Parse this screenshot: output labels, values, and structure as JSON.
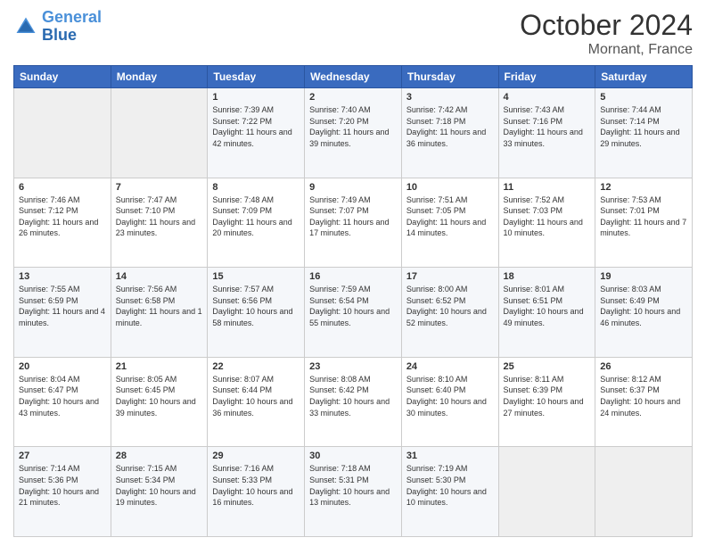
{
  "header": {
    "logo_line1": "General",
    "logo_line2": "Blue",
    "month": "October 2024",
    "location": "Mornant, France"
  },
  "days_of_week": [
    "Sunday",
    "Monday",
    "Tuesday",
    "Wednesday",
    "Thursday",
    "Friday",
    "Saturday"
  ],
  "weeks": [
    [
      {
        "day": "",
        "info": ""
      },
      {
        "day": "",
        "info": ""
      },
      {
        "day": "1",
        "info": "Sunrise: 7:39 AM\nSunset: 7:22 PM\nDaylight: 11 hours and 42 minutes."
      },
      {
        "day": "2",
        "info": "Sunrise: 7:40 AM\nSunset: 7:20 PM\nDaylight: 11 hours and 39 minutes."
      },
      {
        "day": "3",
        "info": "Sunrise: 7:42 AM\nSunset: 7:18 PM\nDaylight: 11 hours and 36 minutes."
      },
      {
        "day": "4",
        "info": "Sunrise: 7:43 AM\nSunset: 7:16 PM\nDaylight: 11 hours and 33 minutes."
      },
      {
        "day": "5",
        "info": "Sunrise: 7:44 AM\nSunset: 7:14 PM\nDaylight: 11 hours and 29 minutes."
      }
    ],
    [
      {
        "day": "6",
        "info": "Sunrise: 7:46 AM\nSunset: 7:12 PM\nDaylight: 11 hours and 26 minutes."
      },
      {
        "day": "7",
        "info": "Sunrise: 7:47 AM\nSunset: 7:10 PM\nDaylight: 11 hours and 23 minutes."
      },
      {
        "day": "8",
        "info": "Sunrise: 7:48 AM\nSunset: 7:09 PM\nDaylight: 11 hours and 20 minutes."
      },
      {
        "day": "9",
        "info": "Sunrise: 7:49 AM\nSunset: 7:07 PM\nDaylight: 11 hours and 17 minutes."
      },
      {
        "day": "10",
        "info": "Sunrise: 7:51 AM\nSunset: 7:05 PM\nDaylight: 11 hours and 14 minutes."
      },
      {
        "day": "11",
        "info": "Sunrise: 7:52 AM\nSunset: 7:03 PM\nDaylight: 11 hours and 10 minutes."
      },
      {
        "day": "12",
        "info": "Sunrise: 7:53 AM\nSunset: 7:01 PM\nDaylight: 11 hours and 7 minutes."
      }
    ],
    [
      {
        "day": "13",
        "info": "Sunrise: 7:55 AM\nSunset: 6:59 PM\nDaylight: 11 hours and 4 minutes."
      },
      {
        "day": "14",
        "info": "Sunrise: 7:56 AM\nSunset: 6:58 PM\nDaylight: 11 hours and 1 minute."
      },
      {
        "day": "15",
        "info": "Sunrise: 7:57 AM\nSunset: 6:56 PM\nDaylight: 10 hours and 58 minutes."
      },
      {
        "day": "16",
        "info": "Sunrise: 7:59 AM\nSunset: 6:54 PM\nDaylight: 10 hours and 55 minutes."
      },
      {
        "day": "17",
        "info": "Sunrise: 8:00 AM\nSunset: 6:52 PM\nDaylight: 10 hours and 52 minutes."
      },
      {
        "day": "18",
        "info": "Sunrise: 8:01 AM\nSunset: 6:51 PM\nDaylight: 10 hours and 49 minutes."
      },
      {
        "day": "19",
        "info": "Sunrise: 8:03 AM\nSunset: 6:49 PM\nDaylight: 10 hours and 46 minutes."
      }
    ],
    [
      {
        "day": "20",
        "info": "Sunrise: 8:04 AM\nSunset: 6:47 PM\nDaylight: 10 hours and 43 minutes."
      },
      {
        "day": "21",
        "info": "Sunrise: 8:05 AM\nSunset: 6:45 PM\nDaylight: 10 hours and 39 minutes."
      },
      {
        "day": "22",
        "info": "Sunrise: 8:07 AM\nSunset: 6:44 PM\nDaylight: 10 hours and 36 minutes."
      },
      {
        "day": "23",
        "info": "Sunrise: 8:08 AM\nSunset: 6:42 PM\nDaylight: 10 hours and 33 minutes."
      },
      {
        "day": "24",
        "info": "Sunrise: 8:10 AM\nSunset: 6:40 PM\nDaylight: 10 hours and 30 minutes."
      },
      {
        "day": "25",
        "info": "Sunrise: 8:11 AM\nSunset: 6:39 PM\nDaylight: 10 hours and 27 minutes."
      },
      {
        "day": "26",
        "info": "Sunrise: 8:12 AM\nSunset: 6:37 PM\nDaylight: 10 hours and 24 minutes."
      }
    ],
    [
      {
        "day": "27",
        "info": "Sunrise: 7:14 AM\nSunset: 5:36 PM\nDaylight: 10 hours and 21 minutes."
      },
      {
        "day": "28",
        "info": "Sunrise: 7:15 AM\nSunset: 5:34 PM\nDaylight: 10 hours and 19 minutes."
      },
      {
        "day": "29",
        "info": "Sunrise: 7:16 AM\nSunset: 5:33 PM\nDaylight: 10 hours and 16 minutes."
      },
      {
        "day": "30",
        "info": "Sunrise: 7:18 AM\nSunset: 5:31 PM\nDaylight: 10 hours and 13 minutes."
      },
      {
        "day": "31",
        "info": "Sunrise: 7:19 AM\nSunset: 5:30 PM\nDaylight: 10 hours and 10 minutes."
      },
      {
        "day": "",
        "info": ""
      },
      {
        "day": "",
        "info": ""
      }
    ]
  ]
}
